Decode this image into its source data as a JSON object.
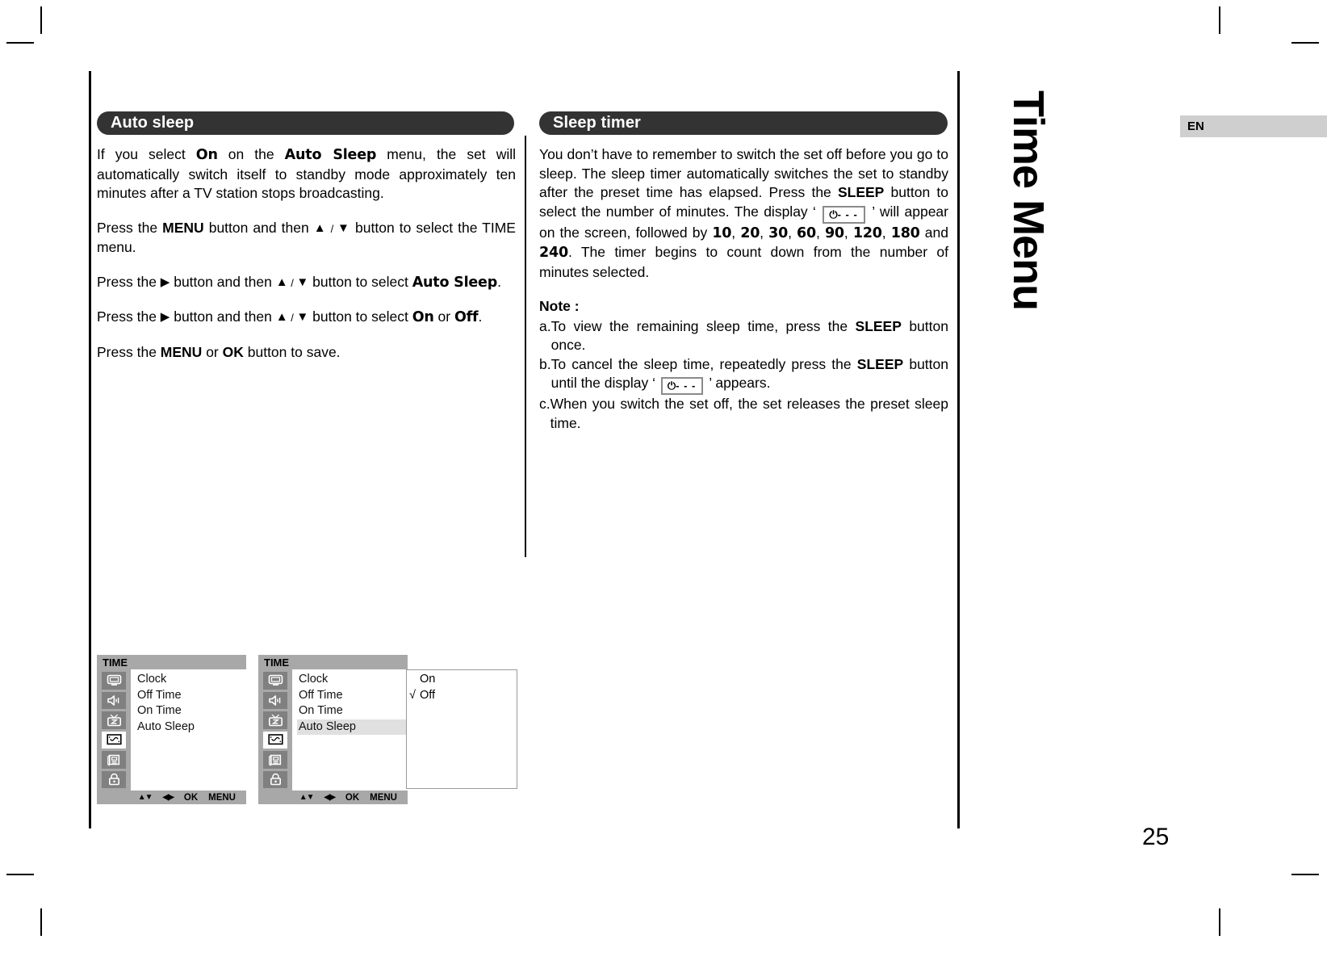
{
  "sidebar": {
    "vertical_title": "Time Menu",
    "language_tab": "EN"
  },
  "page_number": "25",
  "left_column": {
    "header": "Auto sleep",
    "p1": {
      "t1": "If you select ",
      "on": "On",
      "t2": " on the ",
      "auto_sleep": "Auto Sleep",
      "t3": " menu, the set will automatically switch itself to standby mode approximately ten minutes after a TV station stops broadcasting."
    },
    "p2": {
      "t1": "Press the ",
      "menu": "MENU",
      "t2": " button and then ",
      "up": "▲",
      "slash": " / ",
      "down": "▼",
      "t3": " button to select the TIME menu."
    },
    "p3": {
      "t1": "Press the ",
      "right": "▶",
      "t2": " button and then ",
      "up": "▲",
      "slash": " / ",
      "down": "▼",
      "t3": " button to select ",
      "auto_sleep": "Auto Sleep",
      "t4": "."
    },
    "p4": {
      "t1": "Press the ",
      "right": "▶",
      "t2": " button and then ",
      "up": "▲",
      "slash": " / ",
      "down": "▼",
      "t3": " button to select ",
      "on": "On",
      "t4": " or ",
      "off": "Off",
      "t5": "."
    },
    "p5": {
      "t1": "Press the ",
      "menu": "MENU",
      "t2": " or ",
      "ok": "OK",
      "t3": " button to save."
    }
  },
  "right_column": {
    "header": "Sleep timer",
    "p1": {
      "t1": "You don’t have to remember to switch the set off before you go to sleep. The sleep timer automatically switches the set to standby after the preset time has elapsed. Press the ",
      "sleep": "SLEEP",
      "t2": " button to select the number of minutes. The display ‘ ",
      "display_power": "⏻",
      "display_dashes": "- - -",
      "t3": " ’ will appear on the screen, followed by ",
      "v10": "10",
      "c1": ", ",
      "v20": "20",
      "c2": ", ",
      "v30": "30",
      "c3": ", ",
      "v60": "60",
      "c4": ", ",
      "v90": "90",
      "c5": ", ",
      "v120": "120",
      "c6": ", ",
      "v180": "180",
      "t4": " and ",
      "v240": "240",
      "t5": ". The timer begins to count down from the number of minutes selected."
    },
    "note_title": "Note :",
    "notes": [
      {
        "label": "a.",
        "t1": "To view the remaining sleep time, press the ",
        "bold": "SLEEP",
        "t2": " button once."
      },
      {
        "label": "b.",
        "t1": "To cancel the sleep time, repeatedly press the ",
        "bold": "SLEEP",
        "t2": " button until the display ‘ ",
        "display_power": "⏻",
        "display_dashes": "- - -",
        "t3": " ’ appears."
      },
      {
        "label": "c.",
        "t1": "When you switch the set off, the set releases the preset sleep time.",
        "bold": "",
        "t2": ""
      }
    ]
  },
  "osd_menus": [
    {
      "title": "TIME",
      "icons": [
        "picture-icon",
        "sound-icon",
        "channel-icon",
        "time-icon",
        "special-icon",
        "lock-icon"
      ],
      "active_icon_index": 3,
      "items": [
        "Clock",
        "Off Time",
        "On Time",
        "Auto Sleep"
      ],
      "selected_index": -1,
      "footer": {
        "updown": "▲▼",
        "leftright": "◀▶",
        "ok": "OK",
        "menu": "MENU"
      }
    },
    {
      "title": "TIME",
      "icons": [
        "picture-icon",
        "sound-icon",
        "channel-icon",
        "time-icon",
        "special-icon",
        "lock-icon"
      ],
      "active_icon_index": 3,
      "items": [
        "Clock",
        "Off Time",
        "On Time",
        "Auto Sleep"
      ],
      "selected_index": 3,
      "footer": {
        "updown": "▲▼",
        "leftright": "◀▶",
        "ok": "OK",
        "menu": "MENU"
      }
    }
  ],
  "osd_submenu": {
    "options": [
      {
        "check": "",
        "label": "On"
      },
      {
        "check": "√",
        "label": "Off"
      }
    ]
  }
}
